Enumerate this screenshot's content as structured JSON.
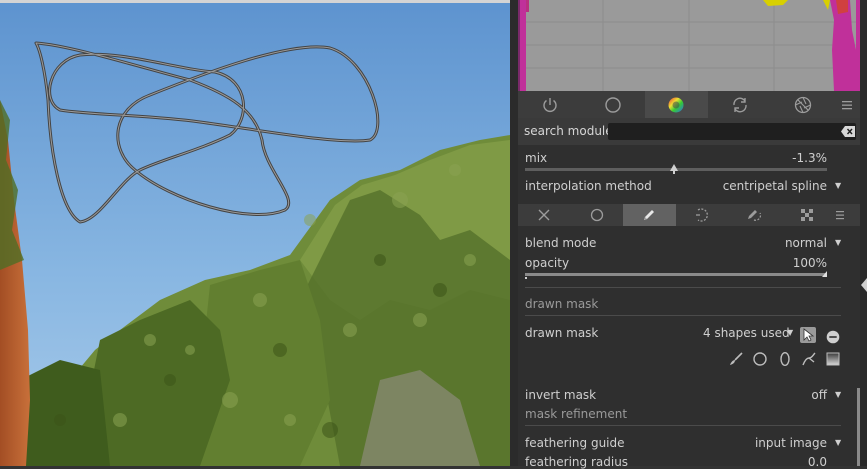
{
  "module_groups": {
    "tabs": [
      {
        "icon": "power-icon",
        "active": false
      },
      {
        "icon": "circle-icon",
        "active": false
      },
      {
        "icon": "color-wheel-icon",
        "active": true
      },
      {
        "icon": "rotate-arrows-icon",
        "active": false
      },
      {
        "icon": "aperture-icon",
        "active": false
      }
    ],
    "menu_icon": "hamburger-menu-icon"
  },
  "search": {
    "label": "search module",
    "value": "",
    "clear_icon": "clear-input-icon"
  },
  "module_params": {
    "mix_label": "mix",
    "mix_value": "-1.3%",
    "mix_level_percent": -1.3,
    "interpolation_label": "interpolation method",
    "interpolation_value": "centripetal spline"
  },
  "mask_tabs": {
    "tabs": [
      {
        "icon": "off-x-icon"
      },
      {
        "icon": "uniform-circle-icon"
      },
      {
        "icon": "pencil-drawn-mask-icon",
        "active": true
      },
      {
        "icon": "parametric-mask-icon"
      },
      {
        "icon": "drawn-parametric-icon"
      },
      {
        "icon": "raster-mask-icon"
      }
    ],
    "menu_icon": "hamburger-menu-icon"
  },
  "blending": {
    "blend_mode_label": "blend mode",
    "blend_mode_value": "normal",
    "opacity_label": "opacity",
    "opacity_value": "100%",
    "opacity_level_percent": 100
  },
  "drawn_mask": {
    "section_title": "drawn mask",
    "label": "drawn mask",
    "shapes_used": "4 shapes used",
    "shape_tools": [
      "brush-icon",
      "circle-shape-icon",
      "ellipse-shape-icon",
      "path-shape-icon",
      "gradient-shape-icon"
    ]
  },
  "invert": {
    "label": "invert mask",
    "value": "off"
  },
  "refinement": {
    "section_title": "mask refinement",
    "feathering_guide_label": "feathering guide",
    "feathering_guide_value": "input image",
    "feathering_radius_label": "feathering radius",
    "feathering_radius_value": "0.0"
  },
  "colors": {
    "panel_bg": "#2f2f2f",
    "histogram_bg": "#9a9a9a",
    "histogram_magenta": "#c0309a",
    "histogram_yellow": "#d8d000",
    "mask_stroke": "#6b6b6b"
  }
}
